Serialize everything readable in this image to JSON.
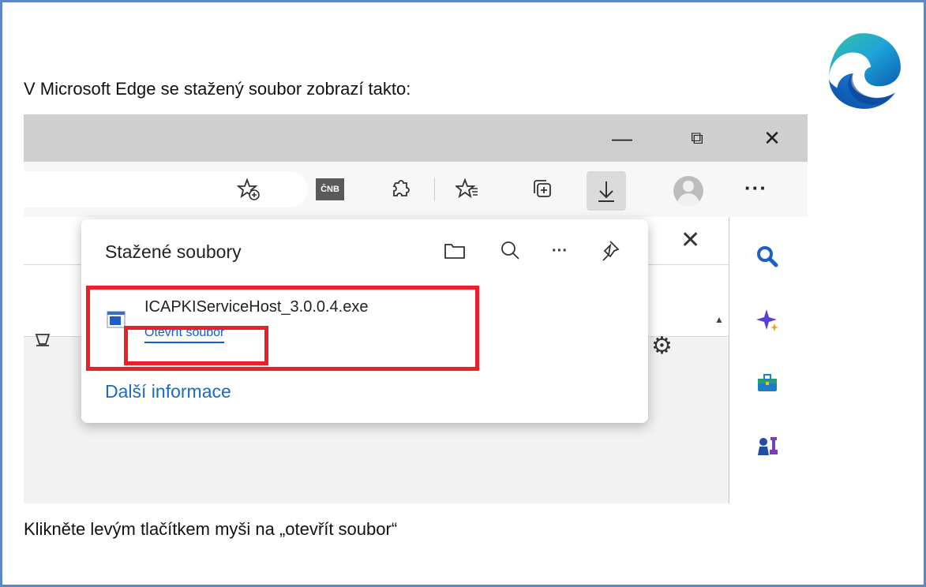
{
  "intro_text": "V Microsoft Edge se stažený soubor zobrazí takto:",
  "instruction_text": "Klikněte levým tlačítkem myši na „otevřít soubor“",
  "colors": {
    "frame": "#5b87c4",
    "highlight": "#e8202a",
    "link": "#1060c9"
  },
  "window_controls": {
    "minimize": "—",
    "restore": "⧉",
    "close": "✕"
  },
  "toolbar": {
    "icons": [
      "favorite-add-icon",
      "cnb-extension-icon",
      "extensions-icon",
      "favorites-icon",
      "collections-icon",
      "downloads-icon",
      "profile-icon"
    ],
    "extension_label": "ČNB",
    "more": "···"
  },
  "downloads_popup": {
    "title": "Stažené soubory",
    "file_name": "ICAPKIServiceHost_3.0.0.4.exe",
    "open_link": "Otevřít soubor",
    "more_info": "Další informace",
    "more": "···"
  },
  "page_panel": {
    "close": "✕",
    "scroll_up": "▲"
  },
  "sidebar": {
    "icons": [
      "search-icon",
      "copilot-icon",
      "tools-icon",
      "games-icon"
    ]
  }
}
